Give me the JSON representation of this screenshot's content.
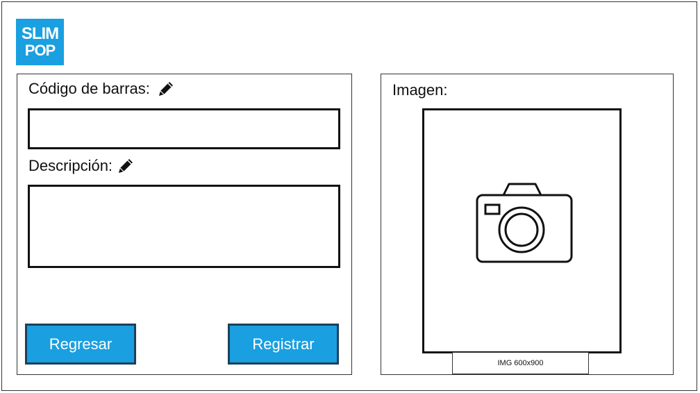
{
  "logo": {
    "line1": "SLIM",
    "line2": "POP"
  },
  "form": {
    "barcode_label": "Código de barras:",
    "barcode_value": "",
    "description_label": "Descripción:",
    "description_value": ""
  },
  "buttons": {
    "back": "Regresar",
    "register": "Registrar"
  },
  "image": {
    "label": "Imagen:",
    "size_tag": "IMG 600x900"
  },
  "colors": {
    "accent": "#1a9fe0",
    "button_border": "#1d3f5c"
  },
  "icons": {
    "edit": "pencil-icon",
    "photo": "camera-icon"
  }
}
